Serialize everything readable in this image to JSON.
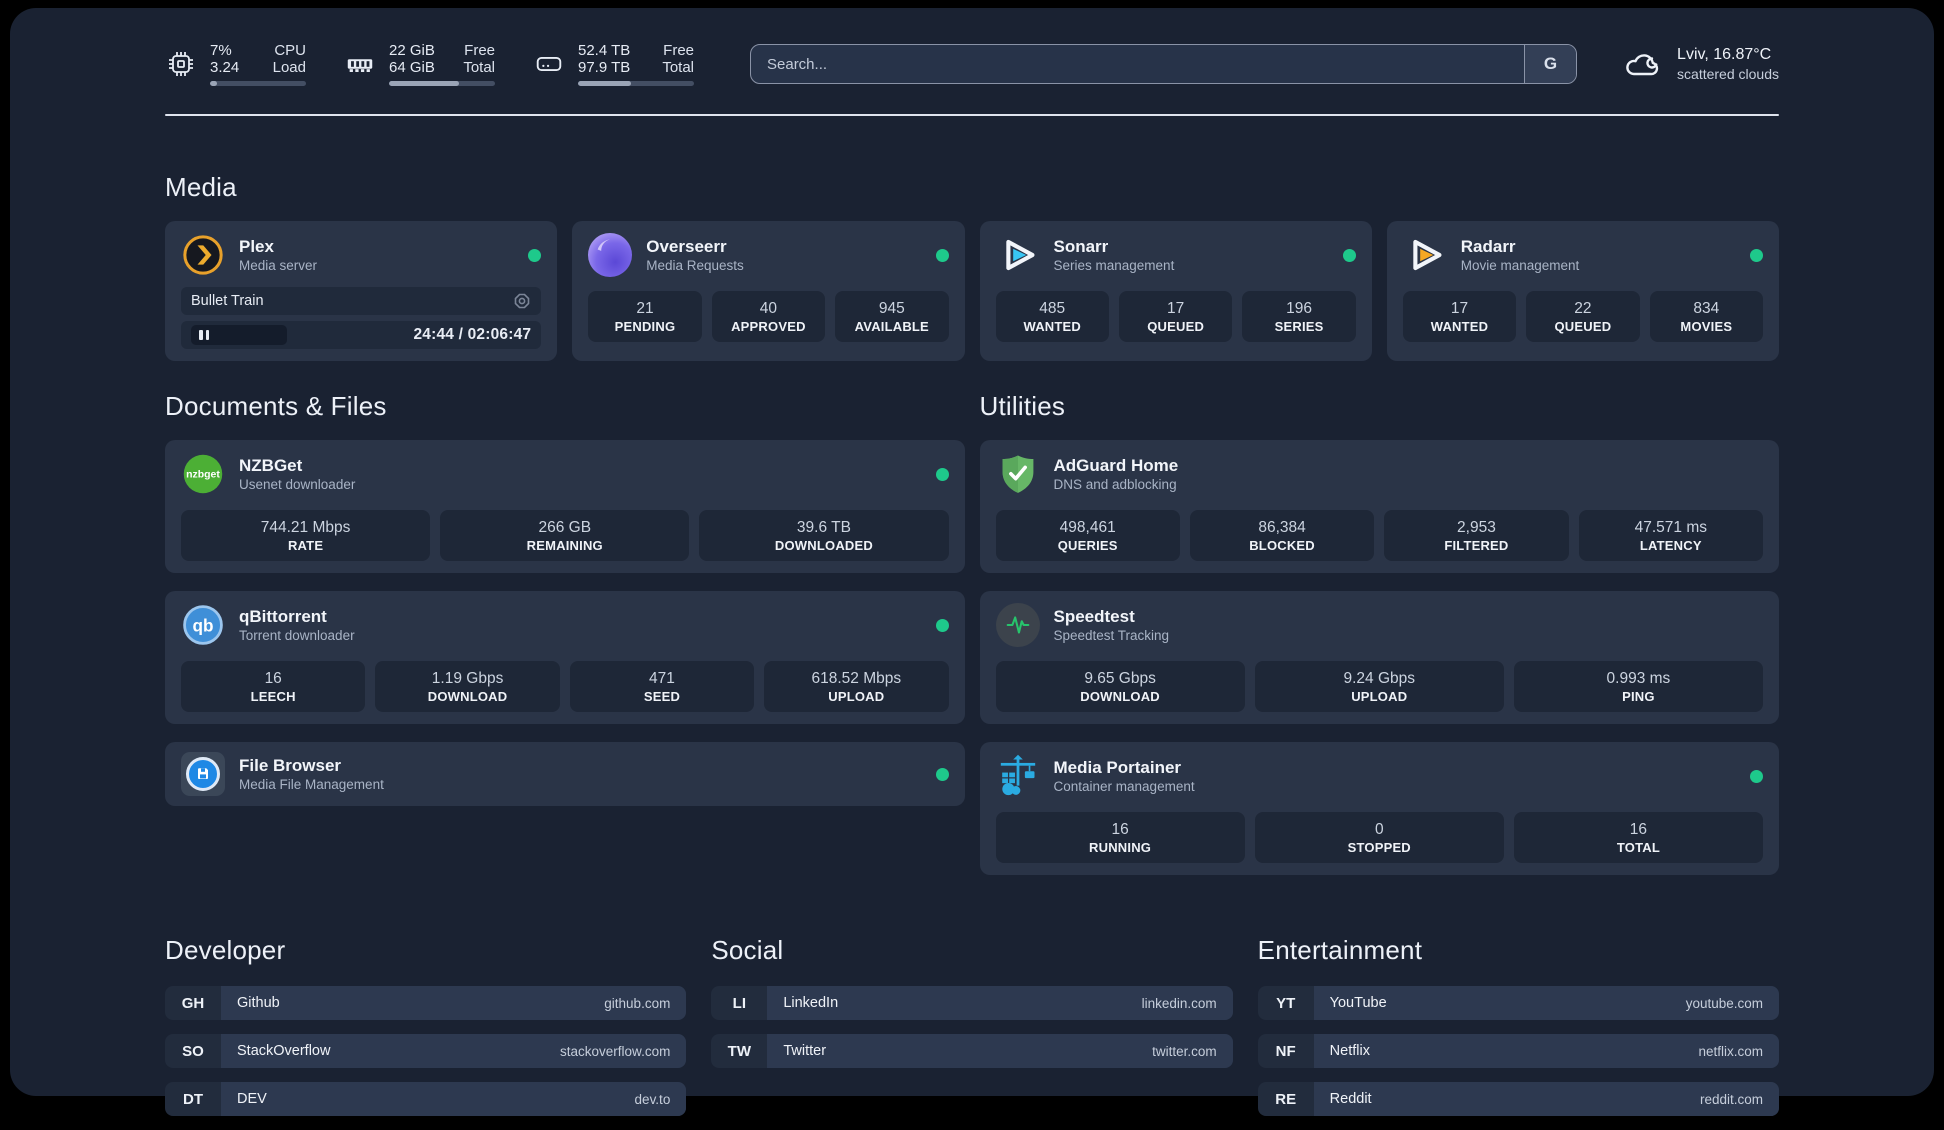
{
  "header": {
    "system_widgets": [
      {
        "icon": "cpu-icon",
        "value1": "7%",
        "value2": "3.24",
        "label1": "CPU",
        "label2": "Load",
        "progress_pct": 7
      },
      {
        "icon": "ram-icon",
        "value1": "22 GiB",
        "value2": "64 GiB",
        "label1": "Free",
        "label2": "Total",
        "progress_pct": 66
      },
      {
        "icon": "disk-icon",
        "value1": "52.4 TB",
        "value2": "97.9 TB",
        "label1": "Free",
        "label2": "Total",
        "progress_pct": 46
      }
    ],
    "search": {
      "placeholder": "Search...",
      "engine_button": "G"
    },
    "weather": {
      "location_temp": "Lviv, 16.87°C",
      "condition": "scattered clouds"
    }
  },
  "media_section": {
    "title": "Media",
    "plex": {
      "name": "Plex",
      "description": "Media server",
      "online": true,
      "now_playing": {
        "title": "Bullet Train",
        "time": "24:44 / 02:06:47"
      }
    },
    "overseerr": {
      "name": "Overseerr",
      "description": "Media Requests",
      "online": true,
      "stats": [
        {
          "value": "21",
          "label": "PENDING"
        },
        {
          "value": "40",
          "label": "APPROVED"
        },
        {
          "value": "945",
          "label": "AVAILABLE"
        }
      ]
    },
    "sonarr": {
      "name": "Sonarr",
      "description": "Series management",
      "online": true,
      "stats": [
        {
          "value": "485",
          "label": "WANTED"
        },
        {
          "value": "17",
          "label": "QUEUED"
        },
        {
          "value": "196",
          "label": "SERIES"
        }
      ]
    },
    "radarr": {
      "name": "Radarr",
      "description": "Movie management",
      "online": true,
      "stats": [
        {
          "value": "17",
          "label": "WANTED"
        },
        {
          "value": "22",
          "label": "QUEUED"
        },
        {
          "value": "834",
          "label": "MOVIES"
        }
      ]
    }
  },
  "documents_section": {
    "title": "Documents & Files",
    "nzbget": {
      "name": "NZBGet",
      "description": "Usenet downloader",
      "online": true,
      "icon_text": "nzbget",
      "stats": [
        {
          "value": "744.21 Mbps",
          "label": "RATE"
        },
        {
          "value": "266 GB",
          "label": "REMAINING"
        },
        {
          "value": "39.6 TB",
          "label": "DOWNLOADED"
        }
      ]
    },
    "qbittorrent": {
      "name": "qBittorrent",
      "description": "Torrent downloader",
      "online": true,
      "icon_text": "qb",
      "stats": [
        {
          "value": "16",
          "label": "LEECH"
        },
        {
          "value": "1.19 Gbps",
          "label": "DOWNLOAD"
        },
        {
          "value": "471",
          "label": "SEED"
        },
        {
          "value": "618.52 Mbps",
          "label": "UPLOAD"
        }
      ]
    },
    "filebrowser": {
      "name": "File Browser",
      "description": "Media File Management",
      "online": true
    }
  },
  "utilities_section": {
    "title": "Utilities",
    "adguard": {
      "name": "AdGuard Home",
      "description": "DNS and adblocking",
      "stats": [
        {
          "value": "498,461",
          "label": "QUERIES"
        },
        {
          "value": "86,384",
          "label": "BLOCKED"
        },
        {
          "value": "2,953",
          "label": "FILTERED"
        },
        {
          "value": "47.571 ms",
          "label": "LATENCY"
        }
      ]
    },
    "speedtest": {
      "name": "Speedtest",
      "description": "Speedtest Tracking",
      "stats": [
        {
          "value": "9.65 Gbps",
          "label": "DOWNLOAD"
        },
        {
          "value": "9.24 Gbps",
          "label": "UPLOAD"
        },
        {
          "value": "0.993 ms",
          "label": "PING"
        }
      ]
    },
    "portainer": {
      "name": "Media Portainer",
      "description": "Container management",
      "online": true,
      "stats": [
        {
          "value": "16",
          "label": "RUNNING"
        },
        {
          "value": "0",
          "label": "STOPPED"
        },
        {
          "value": "16",
          "label": "TOTAL"
        }
      ]
    }
  },
  "bookmarks": [
    {
      "title": "Developer",
      "links": [
        {
          "abbr": "GH",
          "name": "Github",
          "url": "github.com"
        },
        {
          "abbr": "SO",
          "name": "StackOverflow",
          "url": "stackoverflow.com"
        },
        {
          "abbr": "DT",
          "name": "DEV",
          "url": "dev.to"
        }
      ]
    },
    {
      "title": "Social",
      "links": [
        {
          "abbr": "LI",
          "name": "LinkedIn",
          "url": "linkedin.com"
        },
        {
          "abbr": "TW",
          "name": "Twitter",
          "url": "twitter.com"
        }
      ]
    },
    {
      "title": "Entertainment",
      "links": [
        {
          "abbr": "YT",
          "name": "YouTube",
          "url": "youtube.com"
        },
        {
          "abbr": "NF",
          "name": "Netflix",
          "url": "netflix.com"
        },
        {
          "abbr": "RE",
          "name": "Reddit",
          "url": "reddit.com"
        }
      ]
    }
  ]
}
